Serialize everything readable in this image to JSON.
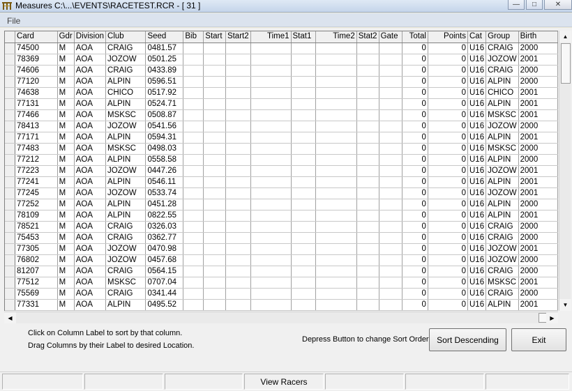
{
  "window": {
    "title": "Measures C:\\...\\EVENTS\\RACETEST.RCR - [  31 ]",
    "app_icon": "measures-app-icon",
    "controls": [
      "minimize-icon",
      "maximize-icon",
      "close-icon"
    ]
  },
  "menu": {
    "file": "File"
  },
  "columns": [
    "",
    "Card",
    "Gdr",
    "Division",
    "Club",
    "Seed",
    "Bib",
    "Start",
    "Start2",
    "Time1",
    "Stat1",
    "Time2",
    "Stat2",
    "Gate",
    "Total",
    "Points",
    "Cat",
    "Group",
    "Birth"
  ],
  "rows": [
    [
      "74500",
      "M",
      "AOA",
      "CRAIG",
      "0481.57",
      "",
      "",
      "",
      "",
      "",
      "",
      "",
      "",
      "0",
      "0",
      "U16",
      "CRAIG",
      "2000"
    ],
    [
      "78369",
      "M",
      "AOA",
      "JOZOW",
      "0501.25",
      "",
      "",
      "",
      "",
      "",
      "",
      "",
      "",
      "0",
      "0",
      "U16",
      "JOZOW",
      "2001"
    ],
    [
      "74606",
      "M",
      "AOA",
      "CRAIG",
      "0433.89",
      "",
      "",
      "",
      "",
      "",
      "",
      "",
      "",
      "0",
      "0",
      "U16",
      "CRAIG",
      "2000"
    ],
    [
      "77120",
      "M",
      "AOA",
      "ALPIN",
      "0596.51",
      "",
      "",
      "",
      "",
      "",
      "",
      "",
      "",
      "0",
      "0",
      "U16",
      "ALPIN",
      "2000"
    ],
    [
      "74638",
      "M",
      "AOA",
      "CHICO",
      "0517.92",
      "",
      "",
      "",
      "",
      "",
      "",
      "",
      "",
      "0",
      "0",
      "U16",
      "CHICO",
      "2001"
    ],
    [
      "77131",
      "M",
      "AOA",
      "ALPIN",
      "0524.71",
      "",
      "",
      "",
      "",
      "",
      "",
      "",
      "",
      "0",
      "0",
      "U16",
      "ALPIN",
      "2001"
    ],
    [
      "77466",
      "M",
      "AOA",
      "MSKSC",
      "0508.87",
      "",
      "",
      "",
      "",
      "",
      "",
      "",
      "",
      "0",
      "0",
      "U16",
      "MSKSC",
      "2001"
    ],
    [
      "78413",
      "M",
      "AOA",
      "JOZOW",
      "0541.56",
      "",
      "",
      "",
      "",
      "",
      "",
      "",
      "",
      "0",
      "0",
      "U16",
      "JOZOW",
      "2000"
    ],
    [
      "77171",
      "M",
      "AOA",
      "ALPIN",
      "0594.31",
      "",
      "",
      "",
      "",
      "",
      "",
      "",
      "",
      "0",
      "0",
      "U16",
      "ALPIN",
      "2001"
    ],
    [
      "77483",
      "M",
      "AOA",
      "MSKSC",
      "0498.03",
      "",
      "",
      "",
      "",
      "",
      "",
      "",
      "",
      "0",
      "0",
      "U16",
      "MSKSC",
      "2000"
    ],
    [
      "77212",
      "M",
      "AOA",
      "ALPIN",
      "0558.58",
      "",
      "",
      "",
      "",
      "",
      "",
      "",
      "",
      "0",
      "0",
      "U16",
      "ALPIN",
      "2000"
    ],
    [
      "77223",
      "M",
      "AOA",
      "JOZOW",
      "0447.26",
      "",
      "",
      "",
      "",
      "",
      "",
      "",
      "",
      "0",
      "0",
      "U16",
      "JOZOW",
      "2001"
    ],
    [
      "77241",
      "M",
      "AOA",
      "ALPIN",
      "0546.11",
      "",
      "",
      "",
      "",
      "",
      "",
      "",
      "",
      "0",
      "0",
      "U16",
      "ALPIN",
      "2001"
    ],
    [
      "77245",
      "M",
      "AOA",
      "JOZOW",
      "0533.74",
      "",
      "",
      "",
      "",
      "",
      "",
      "",
      "",
      "0",
      "0",
      "U16",
      "JOZOW",
      "2001"
    ],
    [
      "77252",
      "M",
      "AOA",
      "ALPIN",
      "0451.28",
      "",
      "",
      "",
      "",
      "",
      "",
      "",
      "",
      "0",
      "0",
      "U16",
      "ALPIN",
      "2000"
    ],
    [
      "78109",
      "M",
      "AOA",
      "ALPIN",
      "0822.55",
      "",
      "",
      "",
      "",
      "",
      "",
      "",
      "",
      "0",
      "0",
      "U16",
      "ALPIN",
      "2001"
    ],
    [
      "78521",
      "M",
      "AOA",
      "CRAIG",
      "0326.03",
      "",
      "",
      "",
      "",
      "",
      "",
      "",
      "",
      "0",
      "0",
      "U16",
      "CRAIG",
      "2000"
    ],
    [
      "75453",
      "M",
      "AOA",
      "CRAIG",
      "0362.77",
      "",
      "",
      "",
      "",
      "",
      "",
      "",
      "",
      "0",
      "0",
      "U16",
      "CRAIG",
      "2000"
    ],
    [
      "77305",
      "M",
      "AOA",
      "JOZOW",
      "0470.98",
      "",
      "",
      "",
      "",
      "",
      "",
      "",
      "",
      "0",
      "0",
      "U16",
      "JOZOW",
      "2001"
    ],
    [
      "76802",
      "M",
      "AOA",
      "JOZOW",
      "0457.68",
      "",
      "",
      "",
      "",
      "",
      "",
      "",
      "",
      "0",
      "0",
      "U16",
      "JOZOW",
      "2000"
    ],
    [
      "81207",
      "M",
      "AOA",
      "CRAIG",
      "0564.15",
      "",
      "",
      "",
      "",
      "",
      "",
      "",
      "",
      "0",
      "0",
      "U16",
      "CRAIG",
      "2000"
    ],
    [
      "77512",
      "M",
      "AOA",
      "MSKSC",
      "0707.04",
      "",
      "",
      "",
      "",
      "",
      "",
      "",
      "",
      "0",
      "0",
      "U16",
      "MSKSC",
      "2001"
    ],
    [
      "75569",
      "M",
      "AOA",
      "CRAIG",
      "0341.44",
      "",
      "",
      "",
      "",
      "",
      "",
      "",
      "",
      "0",
      "0",
      "U16",
      "CRAIG",
      "2000"
    ],
    [
      "77331",
      "M",
      "AOA",
      "ALPIN",
      "0495.52",
      "",
      "",
      "",
      "",
      "",
      "",
      "",
      "",
      "0",
      "0",
      "U16",
      "ALPIN",
      "2001"
    ]
  ],
  "hints": {
    "sort_hint": "Click on Column Label to sort by that column.",
    "drag_hint": "Drag Columns by their Label to desired Location.",
    "depress_hint": "Depress Button to change Sort Order"
  },
  "buttons": {
    "sort": "Sort Descending",
    "exit": "Exit"
  },
  "status": {
    "view_racers": "View Racers"
  }
}
